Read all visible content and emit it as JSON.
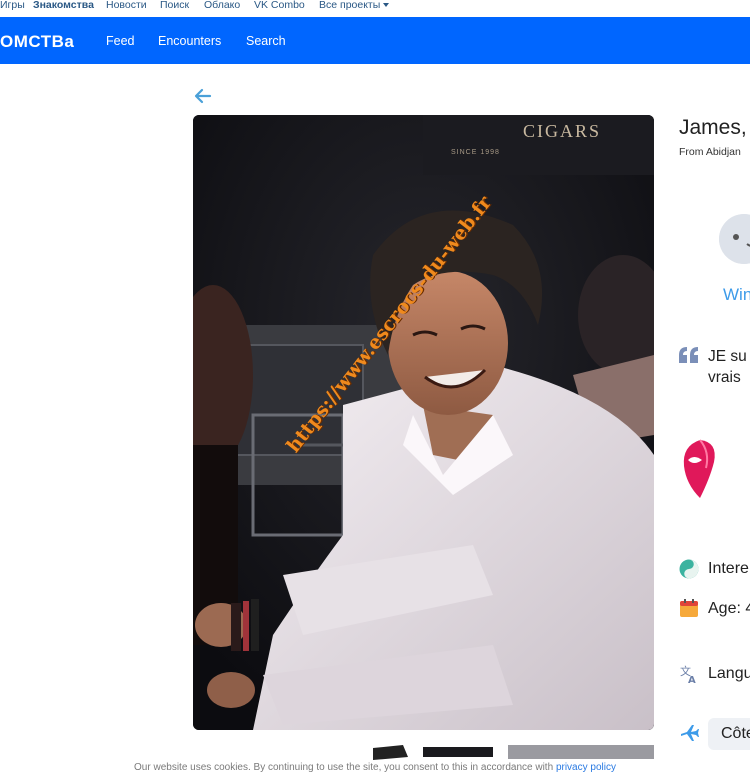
{
  "topbar": {
    "items": [
      "Игры",
      "Знакомства",
      "Новости",
      "Поиск",
      "Облако",
      "VK Combo",
      "Все проекты"
    ]
  },
  "header": {
    "logo": "ОМСТВа",
    "nav": [
      "Feed",
      "Encounters",
      "Search"
    ],
    "color": "#0066ff"
  },
  "photo": {
    "sign_text": "CIGARS",
    "sign_small": "SINCE 1998",
    "watermark": "https://www.escrocs-du-web.fr"
  },
  "profile": {
    "name": "James,",
    "from": "From Abidjan",
    "wink_label": "Win",
    "quote_line1": "JE su",
    "quote_line2": "vrais",
    "interests_label": "Intere",
    "age_label": "Age: 4",
    "languages_label": "Langu",
    "location_chip": "Côte"
  },
  "cookie": {
    "text": "Our website uses cookies. By continuing to use the site, you consent to this in accordance with ",
    "link": "privacy policy"
  }
}
